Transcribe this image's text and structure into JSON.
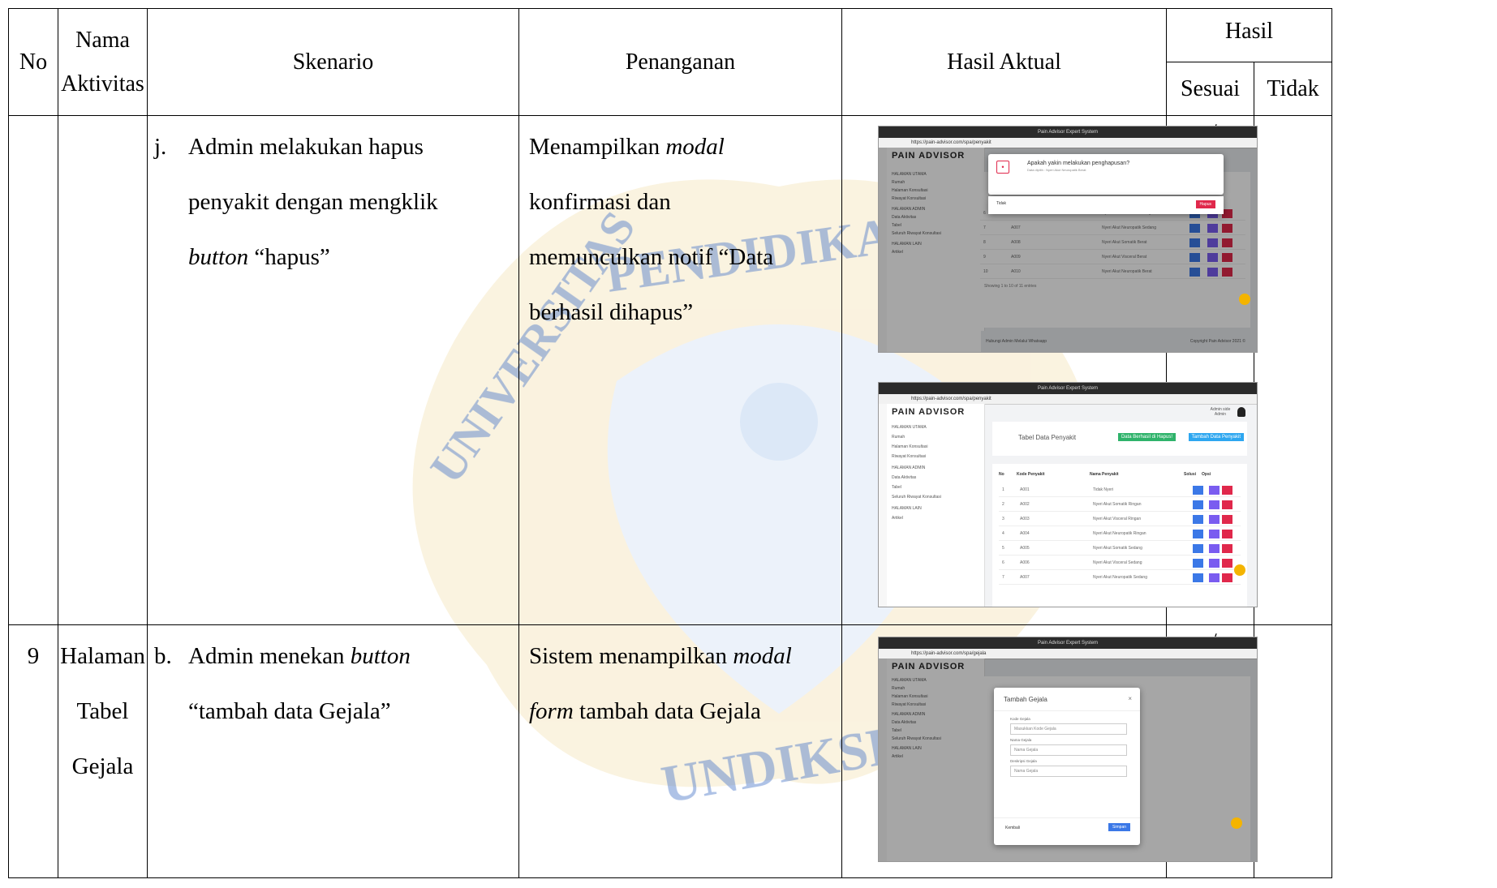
{
  "header": {
    "no": "No",
    "nama": "Nama",
    "aktivitas": "Aktivitas",
    "skenario": "Skenario",
    "penanganan": "Penanganan",
    "hasil_aktual": "Hasil Aktual",
    "hasil": "Hasil",
    "sesuai": "Sesuai",
    "tidak": "Tidak"
  },
  "rows": [
    {
      "no": "",
      "aktivitas": [],
      "letter": "j.",
      "skenario": [
        "Admin melakukan hapus",
        "penyakit dengan mengklik",
        "button",
        " “hapus”"
      ],
      "penanganan": [
        "Menampilkan ",
        "modal",
        "konfirmasi dan",
        "memunculkan notif “Data",
        "berhasil dihapus”"
      ],
      "sesuai": "√",
      "tidak": ""
    },
    {
      "no": "9",
      "aktivitas": [
        "Halaman",
        "Tabel",
        "Gejala"
      ],
      "letter": "b.",
      "skenario": [
        "Admin menekan ",
        "button",
        "“tambah data Gejala”"
      ],
      "penanganan": [
        "Sistem menampilkan ",
        "modal",
        "form",
        " tambah data Gejala"
      ],
      "sesuai": "√",
      "tidak": ""
    }
  ],
  "watermark": {
    "top": "PENDIDIKAN",
    "left": "UNIVERSITAS",
    "bottom": "UNDIKSHA"
  },
  "screens": {
    "window_title": "Pain Advisor Expert System",
    "url1": "https://pain-advisor.com/spa/penyakit",
    "url2": "https://pain-advisor.com/spa/penyakit",
    "url3": "https://pain-advisor.com/spa/gejala",
    "logo": "PAIN ADVISOR",
    "side_items": [
      "HALAMAN UTAMA",
      "Rumah",
      "Halaman Konsultasi",
      "Riwayat Konsultasi",
      "HALAMAN ADMIN",
      "Data Aktivitas",
      "Tabel",
      "Seluruh Riwayat Konsultasi",
      "HALAMAN LAIN",
      "Artikel"
    ],
    "confirm_title": "Apakah yakin melakukan penghapusan?",
    "confirm_sub": "Data dipilih : Nyeri Akut Neuropatik Berat",
    "confirm_no": "Tidak",
    "confirm_yes": "Hapus",
    "table_title": "Tabel Data Penyakit",
    "notif": "Data Berhasil di Hapus!",
    "add_btn": "Tambah Data Penyakit",
    "cols": [
      "No",
      "Kode Penyakit",
      "Nama Penyakit",
      "Solusi",
      "Opsi"
    ],
    "list1": [
      [
        "6",
        "A006",
        "Nyeri Akut Visceral Sedang"
      ],
      [
        "7",
        "A007",
        "Nyeri Akut Neuropatik Sedang"
      ],
      [
        "8",
        "A008",
        "Nyeri Akut Somatik Berat"
      ],
      [
        "9",
        "A009",
        "Nyeri Akut Visceral Berat"
      ],
      [
        "10",
        "A010",
        "Nyeri Akut Neuropatik Berat"
      ]
    ],
    "list2": [
      [
        "1",
        "A001",
        "Tidak Nyeri"
      ],
      [
        "2",
        "A002",
        "Nyeri Akut Somatik Ringan"
      ],
      [
        "3",
        "A003",
        "Nyeri Akut Visceral Ringan"
      ],
      [
        "4",
        "A004",
        "Nyeri Akut Neuropatik Ringan"
      ],
      [
        "5",
        "A005",
        "Nyeri Akut Somatik Sedang"
      ],
      [
        "6",
        "A006",
        "Nyeri Akut Visceral Sedang"
      ],
      [
        "7",
        "A007",
        "Nyeri Akut Neuropatik Sedang"
      ]
    ],
    "showing": "Showing 1 to 10 of 11 entries",
    "footer_left": "Hubungi Admin Melalui Whatsapp",
    "footer_right": "Copyright Pain Advisor 2021 ©",
    "admin": "Admin side Admin",
    "modal2_title": "Tambah Gejala",
    "f1_label": "Kode Gejala",
    "f1_ph": "Masukkan Kode Gejala",
    "f2_label": "Nama Gejala",
    "f2_ph": "Nama Gejala",
    "f3_label": "Deskripsi Gejala",
    "f3_ph": "Nama Gejala",
    "back": "Kembali",
    "save": "Simpan"
  }
}
